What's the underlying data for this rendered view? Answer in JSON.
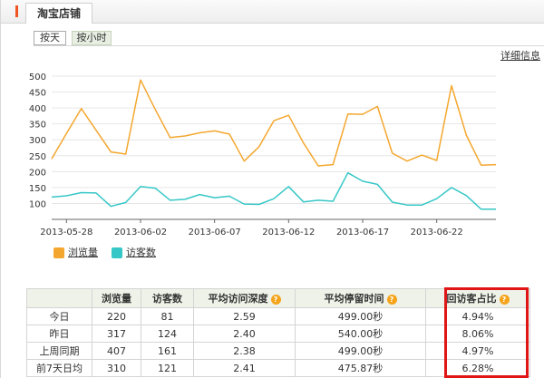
{
  "header": {
    "title": "淘宝店铺"
  },
  "mode_tabs": [
    {
      "label": "按天",
      "active": true
    },
    {
      "label": "按小时",
      "active": false
    }
  ],
  "detail_link": "详细信息",
  "chart_data": {
    "type": "line",
    "title": "",
    "xlabel": "",
    "ylabel": "",
    "ylim": [
      50,
      500
    ],
    "yticks": [
      100,
      150,
      200,
      250,
      300,
      350,
      400,
      450,
      500
    ],
    "grid": true,
    "legend_position": "bottom-left",
    "x_tick_labels": [
      "2013-05-28",
      "2013-06-02",
      "2013-06-07",
      "2013-06-12",
      "2013-06-17",
      "2013-06-22"
    ],
    "x": [
      "2013-05-27",
      "2013-05-28",
      "2013-05-29",
      "2013-05-30",
      "2013-05-31",
      "2013-06-01",
      "2013-06-02",
      "2013-06-03",
      "2013-06-04",
      "2013-06-05",
      "2013-06-06",
      "2013-06-07",
      "2013-06-08",
      "2013-06-09",
      "2013-06-10",
      "2013-06-11",
      "2013-06-12",
      "2013-06-13",
      "2013-06-14",
      "2013-06-15",
      "2013-06-16",
      "2013-06-17",
      "2013-06-18",
      "2013-06-19",
      "2013-06-20",
      "2013-06-21",
      "2013-06-22",
      "2013-06-23",
      "2013-06-24",
      "2013-06-25",
      "2013-06-26"
    ],
    "series": [
      {
        "name": "浏览量",
        "color": "#f4a72f",
        "values": [
          240,
          320,
          398,
          330,
          262,
          255,
          488,
          395,
          307,
          312,
          322,
          328,
          318,
          233,
          278,
          360,
          377,
          290,
          218,
          222,
          381,
          380,
          405,
          258,
          233,
          252,
          235,
          470,
          315,
          220,
          222
        ]
      },
      {
        "name": "访客数",
        "color": "#37c7c7",
        "values": [
          120,
          124,
          134,
          133,
          91,
          103,
          153,
          148,
          110,
          113,
          128,
          118,
          123,
          98,
          97,
          115,
          153,
          105,
          110,
          107,
          196,
          170,
          160,
          104,
          95,
          95,
          115,
          150,
          125,
          82,
          82
        ]
      }
    ]
  },
  "stats_table": {
    "columns": [
      "",
      "浏览量",
      "访客数",
      "平均访问深度",
      "平均停留时间",
      "回访客占比"
    ],
    "rows": [
      {
        "label": "今日",
        "pv": "220",
        "uv": "81",
        "depth": "2.59",
        "stay": "499.00秒",
        "return": "4.94%"
      },
      {
        "label": "昨日",
        "pv": "317",
        "uv": "124",
        "depth": "2.40",
        "stay": "540.00秒",
        "return": "8.06%"
      },
      {
        "label": "上周同期",
        "pv": "407",
        "uv": "161",
        "depth": "2.38",
        "stay": "499.00秒",
        "return": "4.97%"
      },
      {
        "label": "前7天日均",
        "pv": "310",
        "uv": "121",
        "depth": "2.41",
        "stay": "475.87秒",
        "return": "6.28%"
      }
    ]
  },
  "colors": {
    "pv_line": "#f4a72f",
    "uv_line": "#37c7c7",
    "highlight": "#e01515",
    "help_icon": "#f5a41a"
  }
}
